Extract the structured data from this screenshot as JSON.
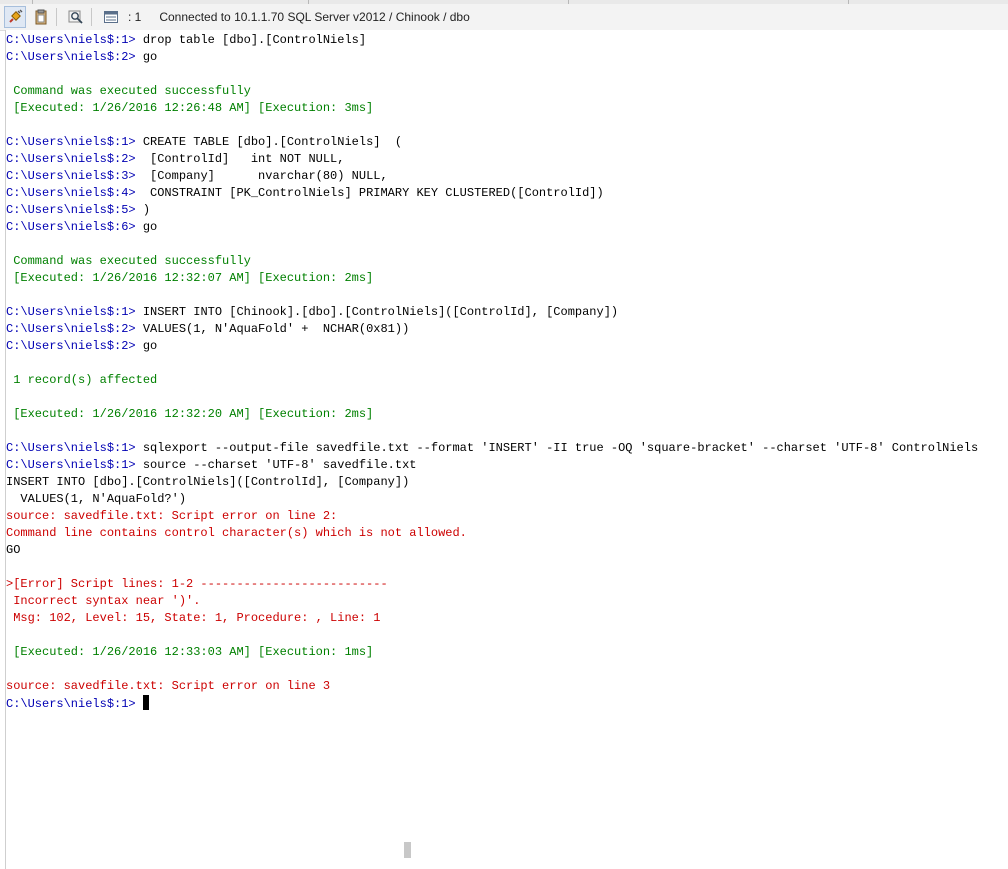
{
  "toolbar": {
    "tab_count": "1",
    "status": "Connected to 10.1.1.70 SQL Server v2012 / Chinook / dbo",
    "icons": [
      "plug-icon",
      "clipboard-icon",
      "zoom-icon",
      "list-icon"
    ]
  },
  "console": {
    "lines": [
      {
        "cls": "mix",
        "prompt": "C:\\Users\\niels$:1> ",
        "text": "drop table [dbo].[ControlNiels]"
      },
      {
        "cls": "mix",
        "prompt": "C:\\Users\\niels$:2> ",
        "text": "go"
      },
      {
        "cls": "blank",
        "text": ""
      },
      {
        "cls": "ok",
        "text": " Command was executed successfully"
      },
      {
        "cls": "ok",
        "text": " [Executed: 1/26/2016 12:26:48 AM] [Execution: 3ms]"
      },
      {
        "cls": "blank",
        "text": ""
      },
      {
        "cls": "mix",
        "prompt": "C:\\Users\\niels$:1> ",
        "text": "CREATE TABLE [dbo].[ControlNiels]  ("
      },
      {
        "cls": "mix",
        "prompt": "C:\\Users\\niels$:2> ",
        "text": " [ControlId]   int NOT NULL,"
      },
      {
        "cls": "mix",
        "prompt": "C:\\Users\\niels$:3> ",
        "text": " [Company]      nvarchar(80) NULL,"
      },
      {
        "cls": "mix",
        "prompt": "C:\\Users\\niels$:4> ",
        "text": " CONSTRAINT [PK_ControlNiels] PRIMARY KEY CLUSTERED([ControlId])"
      },
      {
        "cls": "mix",
        "prompt": "C:\\Users\\niels$:5> ",
        "text": ")"
      },
      {
        "cls": "mix",
        "prompt": "C:\\Users\\niels$:6> ",
        "text": "go"
      },
      {
        "cls": "blank",
        "text": ""
      },
      {
        "cls": "ok",
        "text": " Command was executed successfully"
      },
      {
        "cls": "ok",
        "text": " [Executed: 1/26/2016 12:32:07 AM] [Execution: 2ms]"
      },
      {
        "cls": "blank",
        "text": ""
      },
      {
        "cls": "mix",
        "prompt": "C:\\Users\\niels$:1> ",
        "text": "INSERT INTO [Chinook].[dbo].[ControlNiels]([ControlId], [Company])"
      },
      {
        "cls": "mix",
        "prompt": "C:\\Users\\niels$:2> ",
        "text": "VALUES(1, N'AquaFold' +  NCHAR(0x81))"
      },
      {
        "cls": "mix",
        "prompt": "C:\\Users\\niels$:2> ",
        "text": "go"
      },
      {
        "cls": "blank",
        "text": ""
      },
      {
        "cls": "ok",
        "text": " 1 record(s) affected"
      },
      {
        "cls": "blank",
        "text": ""
      },
      {
        "cls": "ok",
        "text": " [Executed: 1/26/2016 12:32:20 AM] [Execution: 2ms]"
      },
      {
        "cls": "blank",
        "text": ""
      },
      {
        "cls": "mix",
        "prompt": "C:\\Users\\niels$:1> ",
        "text": "sqlexport --output-file savedfile.txt --format 'INSERT' -II true -OQ 'square-bracket' --charset 'UTF-8' ControlNiels"
      },
      {
        "cls": "mix",
        "prompt": "C:\\Users\\niels$:1> ",
        "text": "source --charset 'UTF-8' savedfile.txt"
      },
      {
        "cls": "plain",
        "text": "INSERT INTO [dbo].[ControlNiels]([ControlId], [Company])"
      },
      {
        "cls": "plain",
        "text": "  VALUES(1, N'AquaFold?')"
      },
      {
        "cls": "err",
        "text": "source: savedfile.txt: Script error on line 2:"
      },
      {
        "cls": "err",
        "text": "Command line contains control character(s) which is not allowed."
      },
      {
        "cls": "plain",
        "text": "GO"
      },
      {
        "cls": "blank",
        "text": ""
      },
      {
        "cls": "err",
        "text": ">[Error] Script lines: 1-2 --------------------------"
      },
      {
        "cls": "err",
        "text": " Incorrect syntax near ')'."
      },
      {
        "cls": "err",
        "text": " Msg: 102, Level: 15, State: 1, Procedure: , Line: 1"
      },
      {
        "cls": "blank",
        "text": ""
      },
      {
        "cls": "ok",
        "text": " [Executed: 1/26/2016 12:33:03 AM] [Execution: 1ms]"
      },
      {
        "cls": "blank",
        "text": ""
      },
      {
        "cls": "err",
        "text": "source: savedfile.txt: Script error on line 3"
      },
      {
        "cls": "cursor",
        "prompt": "C:\\Users\\niels$:1> ",
        "text": ""
      }
    ]
  },
  "colors": {
    "prompt": "#0000b3",
    "success": "#008000",
    "error": "#cc0000"
  }
}
